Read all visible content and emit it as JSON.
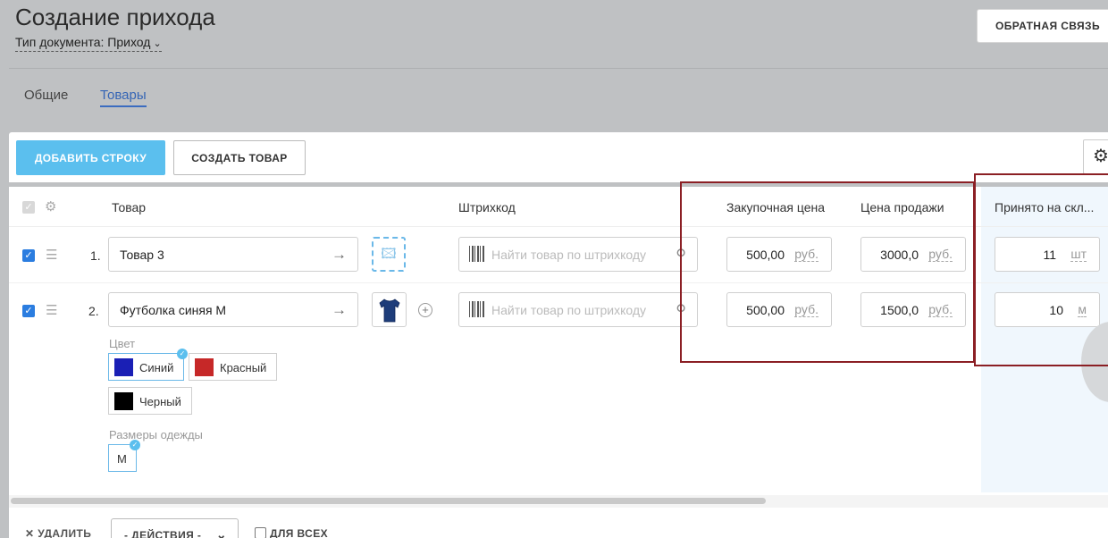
{
  "header": {
    "title": "Создание прихода",
    "doc_type": "Тип документа: Приход",
    "feedback_label": "ОБРАТНАЯ СВЯЗЬ"
  },
  "tabs": [
    {
      "label": "Общие",
      "active": false
    },
    {
      "label": "Товары",
      "active": true
    }
  ],
  "toolbar": {
    "add_row_label": "ДОБАВИТЬ СТРОКУ",
    "create_item_label": "СОЗДАТЬ ТОВАР"
  },
  "table": {
    "columns": {
      "item": "Товар",
      "barcode": "Штрихкод",
      "purchase_price": "Закупочная цена",
      "sale_price": "Цена продажи",
      "received": "Принято на скл..."
    },
    "barcode_placeholder": "Найти товар по штрихкоду",
    "currency": "руб.",
    "rows": [
      {
        "num": "1.",
        "item": "Товар 3",
        "purchase_price": "500,00",
        "sale_price": "3000,0",
        "qty": "11",
        "unit": "шт"
      },
      {
        "num": "2.",
        "item": "Футболка синяя М",
        "purchase_price": "500,00",
        "sale_price": "1500,0",
        "qty": "10",
        "unit": "м",
        "attributes": {
          "color_label": "Цвет",
          "colors": [
            {
              "name": "Синий",
              "hex": "#1a1fb5",
              "selected": true
            },
            {
              "name": "Красный",
              "hex": "#c62828",
              "selected": false
            },
            {
              "name": "Черный",
              "hex": "#000000",
              "selected": false
            }
          ],
          "size_label": "Размеры одежды",
          "sizes": [
            {
              "name": "М",
              "selected": true
            }
          ]
        }
      }
    ]
  },
  "footer": {
    "delete_label": "УДАЛИТЬ",
    "actions_label": "- ДЕЙСТВИЯ -",
    "for_all_label": "ДЛЯ ВСЕХ"
  },
  "colors": {
    "accent": "#5bbfee",
    "tab_active": "#3565b5",
    "highlight": "#8b1f24"
  }
}
